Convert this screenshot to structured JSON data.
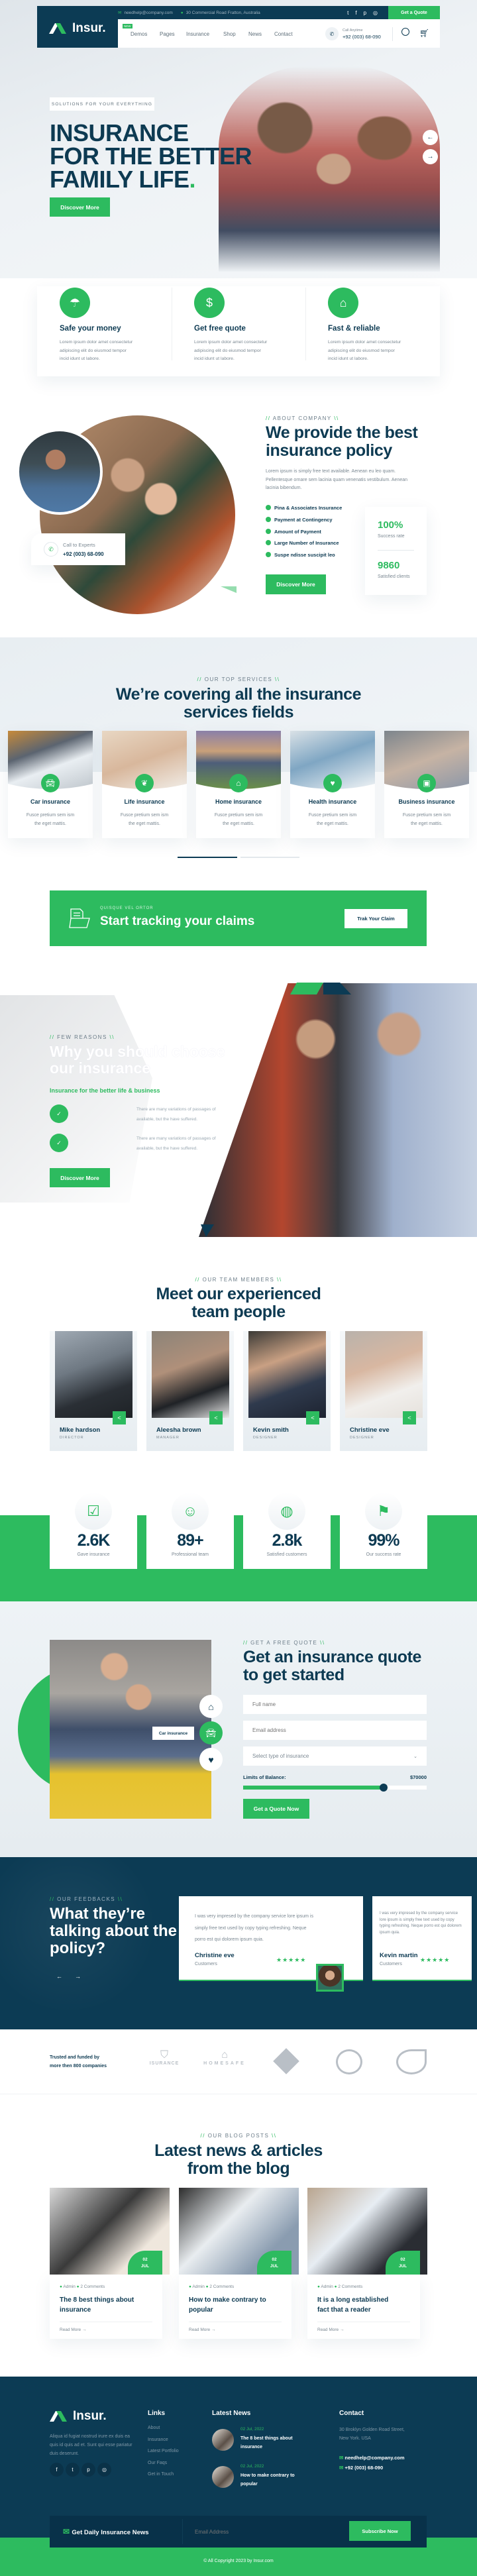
{
  "colors": {
    "navy": "#0c3b54",
    "green": "#2dbb5f",
    "light_bg": "#eef3f6"
  },
  "header": {
    "logo": "Insur.",
    "email": "needhelp@company.com",
    "address": "30 Commercial Road Fratton, Australia",
    "quote_btn": "Get a Quote",
    "new_badge": "NEW",
    "nav": [
      "Demos",
      "Pages",
      "Insurance",
      "Shop",
      "News",
      "Contact"
    ],
    "call_label": "Call Anytime",
    "phone": "+92 (003) 68-090",
    "social_icons": [
      "twitter-icon",
      "facebook-icon",
      "pinterest-icon",
      "instagram-icon"
    ]
  },
  "hero": {
    "badge": "SOLUTIONS FOR YOUR EVERYTHING",
    "title": [
      "INSURANCE",
      "FOR THE BETTER",
      "FAMILY LIFE"
    ],
    "title_dot": ".",
    "button": "Discover More",
    "prev": "←",
    "next": "→"
  },
  "features": [
    {
      "icon": "umbrella-money-icon",
      "title": "Safe your money",
      "text": [
        "Lorem ipsum dolor amet consectetur",
        "adipiscing elit do eiusmod tempor",
        "incid idunt ut labore."
      ]
    },
    {
      "icon": "hand-coin-icon",
      "title": "Get free quote",
      "text": [
        "Lorem ipsum dolor amet consectetur",
        "adipiscing elit do eiusmod tempor",
        "incid idunt ut labore."
      ]
    },
    {
      "icon": "house-shield-icon",
      "title": "Fast & reliable",
      "text": [
        "Lorem ipsum dolor amet consectetur",
        "adipiscing elit do eiusmod tempor",
        "incid idunt ut labore."
      ]
    }
  ],
  "about": {
    "label": "ABOUT COMPANY",
    "title": [
      "We provide the best",
      "insurance policy"
    ],
    "text": [
      "Lorem ipsum is simply free text available. Aenean eu leo quam.",
      "Pellentesque ornare sem lacinia quam venenatis vestibulum. Aenean",
      "lacinia bibendum."
    ],
    "checks": [
      "Pina & Associates Insurance",
      "Payment at Contingency",
      "Amount of Payment",
      "Large Number of Insurance",
      "Suspe ndisse suscipit leo"
    ],
    "stats": [
      {
        "value": "100%",
        "label": "Success rate"
      },
      {
        "value": "9860",
        "label": "Satisfied clients"
      }
    ],
    "button": "Discover More",
    "call_label": "Call to Experts",
    "phone": "+92 (003) 68-090"
  },
  "services": {
    "label": "OUR TOP SERVICES",
    "title": [
      "We’re covering all the insurance",
      "services fields"
    ],
    "items": [
      {
        "title": "Car insurance",
        "icon": "car-icon"
      },
      {
        "title": "Life insurance",
        "icon": "family-heart-icon"
      },
      {
        "title": "Home insurance",
        "icon": "home-icon"
      },
      {
        "title": "Health insurance",
        "icon": "heart-pulse-icon"
      },
      {
        "title": "Business insurance",
        "icon": "briefcase-icon"
      }
    ],
    "desc": [
      "Fusce pretium sem ism",
      "the eget mattis."
    ],
    "pager_active": 0,
    "pager_count": 2
  },
  "claims": {
    "label": "QUISQUE VEL ORTOR",
    "title": "Start tracking your claims",
    "button": "Trak Your Claim"
  },
  "reasons": {
    "label": "FEW REASONS",
    "title": [
      "Why you should choose",
      "our insurance"
    ],
    "subtitle": "Insurance for the better life & business",
    "items": [
      {
        "text": [
          "There are many variations of passages of",
          "available, but the have suffered."
        ]
      },
      {
        "text": [
          "There are many variations of passages of",
          "available, but the have suffered."
        ]
      }
    ],
    "button": "Discover More"
  },
  "team": {
    "label": "OUR TEAM MEMBERS",
    "title": [
      "Meet our experienced",
      "team people"
    ],
    "members": [
      {
        "name": "Mike hardson",
        "role": "DIRECTOR"
      },
      {
        "name": "Aleesha brown",
        "role": "MANAGER"
      },
      {
        "name": "Kevin smith",
        "role": "DESIGNER"
      },
      {
        "name": "Christine eve",
        "role": "DESIGNER"
      }
    ]
  },
  "counters": [
    {
      "value": "2.6K",
      "label": "Gave insurance",
      "icon": "checklist-shield-icon"
    },
    {
      "value": "89+",
      "label": "Professional team",
      "icon": "team-icon"
    },
    {
      "value": "2.8k",
      "label": "Satisfied customers",
      "icon": "customers-globe-icon"
    },
    {
      "value": "99%",
      "label": "Our success rate",
      "icon": "trophy-flag-icon"
    }
  ],
  "quote": {
    "label": "GET A FREE QUOTE",
    "title": [
      "Get an insurance quote",
      "to get started"
    ],
    "name_placeholder": "Full name",
    "email_placeholder": "Email address",
    "select_value": "Select type of insurance",
    "limit_label": "Limits of Balance:",
    "limit_value": "$70000",
    "slider_fraction": 0.765,
    "button": "Get a Quote Now",
    "tooltip": "Car insurance"
  },
  "testimonials": {
    "label": "OUR FEEDBACKS",
    "title": [
      "What they’re",
      "talking about the",
      "policy?"
    ],
    "prev": "←",
    "next": "→",
    "items": [
      {
        "text": [
          "I was very impresed by the company service lore ipsum is",
          "simply free text used by copy typing refreshing. Neque",
          "porro est qui dolorem ipsum quia."
        ],
        "name": "Christine eve",
        "role": "Customers",
        "stars": 5
      },
      {
        "text": [
          "I was very impresed by the company service lore ipsum is",
          "simply free text used by copy typing refreshing. Neque",
          "porro est qui dolorem ipsum quia."
        ],
        "name": "Kevin martin",
        "role": "Customers",
        "stars": 5
      }
    ]
  },
  "brands": {
    "text": [
      "Trusted and funded by",
      "more then 800 companies"
    ],
    "logos": [
      "ISURANCE",
      "HOMESAFE",
      "",
      "",
      ""
    ]
  },
  "blog": {
    "label": "OUR BLOG POSTS",
    "title": [
      "Latest news & articles",
      "from the blog"
    ],
    "posts": [
      {
        "day": "02",
        "month": "JUL",
        "author": "Admin",
        "comments": "2 Comments",
        "title": [
          "The 8 best things about",
          "insurance"
        ],
        "more": "Read More"
      },
      {
        "day": "02",
        "month": "JUL",
        "author": "Admin",
        "comments": "2 Comments",
        "title": [
          "How to make contrary to",
          "popular"
        ],
        "more": "Read More"
      },
      {
        "day": "02",
        "month": "JUL",
        "author": "Admin",
        "comments": "2 Comments",
        "title": [
          "It is a long established",
          "fact that a reader"
        ],
        "more": "Read More"
      }
    ]
  },
  "footer": {
    "logo": "Insur.",
    "about": [
      "Aliqua id fugiat nostrud irure ex duis ea",
      "quis id quis ad et. Sunt qui esse pariatur",
      "duis deserunt."
    ],
    "links_title": "Links",
    "links": [
      "About",
      "Insurance",
      "Latest Portfolio",
      "Our Faqs",
      "Get in Touch"
    ],
    "news_title": "Latest News",
    "news": [
      {
        "date": "02 Jul, 2022",
        "title": [
          "The 8 best things about",
          "insurance"
        ]
      },
      {
        "date": "02 Jul, 2022",
        "title": [
          "How to make contrary to",
          "popular"
        ]
      }
    ],
    "contact_title": "Contact",
    "address": [
      "30 Broklyn Golden Road Street,",
      "New York. USA"
    ],
    "email": "needhelp@company.com",
    "phone": "+92 (003) 68-090",
    "newsletter_title": "Get Daily Insurance News",
    "newsletter_placeholder": "Email Address",
    "subscribe": "Subscribe Now",
    "copyright": "© All Copyright 2023 by Insur.com"
  }
}
